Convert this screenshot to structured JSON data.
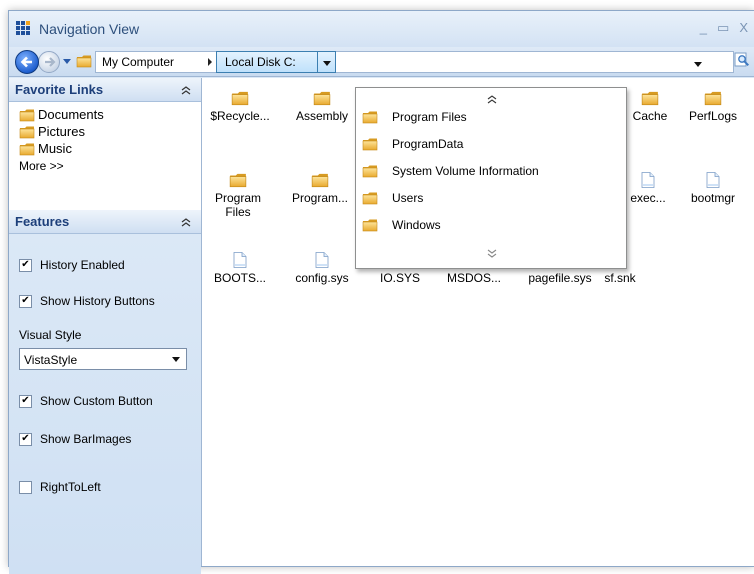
{
  "window": {
    "title": "Navigation View",
    "controls": {
      "minimize": "_",
      "maximize": "▭",
      "close": "X"
    }
  },
  "address": {
    "crumbs": [
      "My Computer",
      "Local Disk C:"
    ]
  },
  "favorites": {
    "header": "Favorite Links",
    "items": [
      "Documents",
      "Pictures",
      "Music"
    ],
    "more": "More >>"
  },
  "features": {
    "header": "Features",
    "history_enabled": {
      "label": "History Enabled",
      "checked": true
    },
    "show_history_buttons": {
      "label": "Show History Buttons",
      "checked": true
    },
    "visual_style": {
      "label": "Visual Style",
      "value": "VistaStyle"
    },
    "show_custom_button": {
      "label": "Show Custom Button",
      "checked": true
    },
    "show_barimages": {
      "label": "Show BarImages",
      "checked": true
    },
    "right_to_left": {
      "label": "RightToLeft",
      "checked": false
    }
  },
  "files": [
    {
      "name": "$Recycle...",
      "type": "folder"
    },
    {
      "name": "Assembly",
      "type": "folder"
    },
    {
      "name": "Cache",
      "type": "folder"
    },
    {
      "name": "PerfLogs",
      "type": "folder"
    },
    {
      "name": "Program Files",
      "type": "folder"
    },
    {
      "name": "Program...",
      "type": "folder"
    },
    {
      "name": "exec...",
      "type": "file"
    },
    {
      "name": "bootmgr",
      "type": "file"
    },
    {
      "name": "BOOTS...",
      "type": "file"
    },
    {
      "name": "config.sys",
      "type": "file"
    },
    {
      "name": "IO.SYS",
      "type": "file"
    },
    {
      "name": "MSDOS...",
      "type": "file"
    },
    {
      "name": "pagefile.sys",
      "type": "file"
    },
    {
      "name": "sf.snk",
      "type": "file"
    }
  ],
  "dropdown": {
    "items": [
      "Program Files",
      "ProgramData",
      "System Volume Information",
      "Users",
      "Windows"
    ]
  },
  "colors": {
    "folder": "#f2c04a",
    "accent": "#1f5fcf",
    "titletext": "#2d4f7c"
  }
}
